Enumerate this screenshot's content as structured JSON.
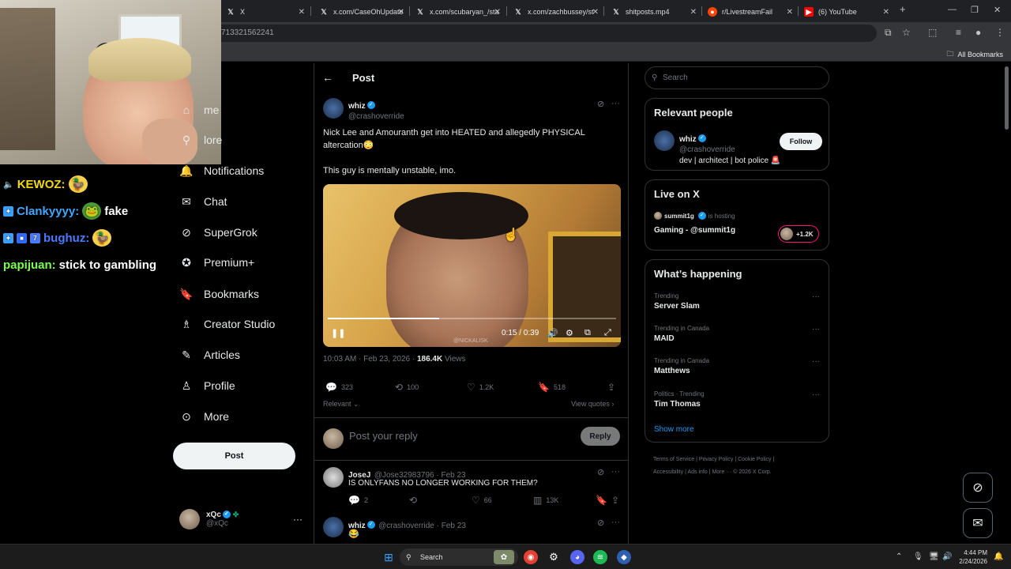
{
  "browser": {
    "tabs": [
      {
        "label": "X",
        "icon": "x-logo-icon"
      },
      {
        "label": "x.com/CaseOhUpdate",
        "icon": "x-logo-icon"
      },
      {
        "label": "x.com/scubaryan_/sta",
        "icon": "x-logo-icon"
      },
      {
        "label": "x.com/zachbussey/st",
        "icon": "x-logo-icon"
      },
      {
        "label": "shitposts.mp4",
        "icon": "x-logo-icon"
      },
      {
        "label": "r/LivestreamFail",
        "icon": "reddit-icon"
      },
      {
        "label": "(6) YouTube",
        "icon": "youtube-icon"
      }
    ],
    "new_tab": "+",
    "address": "713321562241",
    "all_bookmarks": "All Bookmarks"
  },
  "chat": [
    {
      "user": "KEWOZ:",
      "color": "#f5d90a",
      "message": ""
    },
    {
      "user": "Clankyyyy:",
      "color": "#3ea6ff",
      "message": "fake"
    },
    {
      "user": "bughuz:",
      "color": "#4a7bff",
      "message": ""
    },
    {
      "user": "papijuan:",
      "color": "#7cff4f",
      "message": "stick to gambling"
    }
  ],
  "nav": {
    "items": [
      {
        "label": "me",
        "icon": "home-icon"
      },
      {
        "label": "lore",
        "icon": "search-icon"
      },
      {
        "label": "Notifications",
        "icon": "bell-icon"
      },
      {
        "label": "Chat",
        "icon": "mail-icon"
      },
      {
        "label": "SuperGrok",
        "icon": "grok-icon"
      },
      {
        "label": "Premium+",
        "icon": "verified-icon"
      },
      {
        "label": "Bookmarks",
        "icon": "bookmark-icon"
      },
      {
        "label": "Creator Studio",
        "icon": "creator-studio-icon"
      },
      {
        "label": "Articles",
        "icon": "articles-icon"
      },
      {
        "label": "Profile",
        "icon": "person-icon"
      },
      {
        "label": "More",
        "icon": "more-circle-icon"
      }
    ],
    "post_button": "Post",
    "account": {
      "name": "xQc",
      "handle": "@xQc"
    }
  },
  "main": {
    "header_title": "Post",
    "tweet": {
      "name": "whiz",
      "handle": "@crashoverride",
      "text_line1": "Nick Lee and Amouranth get into HEATED and allegedly PHYSICAL",
      "text_line2": "altercation😳",
      "text_line3": "This guy is mentally unstable, imo.",
      "video_time": "0:15 / 0:39",
      "video_progress": 0.385,
      "video_watermark": "@NICKALISK",
      "timestamp": "10:03 AM · Feb 23, 2026 · ",
      "views_count": "186.4K",
      "views_label": " Views",
      "replies": "323",
      "reposts": "100",
      "likes": "1.2K",
      "bookmarks": "518"
    },
    "sort_label": "Relevant",
    "view_quotes": "View quotes",
    "reply_placeholder": "Post your reply",
    "reply_button": "Reply",
    "replies": [
      {
        "name": "JoseJ",
        "handle": "@Jose32983796 · Feb 23",
        "text": "IS ONLYFANS NO LONGER WORKING FOR THEM?",
        "replies": "2",
        "likes": "66",
        "views": "13K"
      },
      {
        "name": "whiz",
        "handle": "@crashoverride · Feb 23",
        "text": "😂"
      }
    ]
  },
  "sidebar": {
    "search_placeholder": "Search",
    "relevant_title": "Relevant people",
    "person": {
      "name": "whiz",
      "handle": "@crashoverride",
      "bio": "dev | architect | bot police 🚨",
      "follow": "Follow"
    },
    "live_title": "Live on X",
    "live": {
      "host": "summit1g",
      "hosting_label": "is hosting",
      "title": "Gaming - @summit1g",
      "listeners": "+1.2K"
    },
    "happening_title": "What’s happening",
    "trends": [
      {
        "category": "Trending",
        "name": "Server Slam"
      },
      {
        "category": "Trending in Canada",
        "name": "MAID"
      },
      {
        "category": "Trending in Canada",
        "name": "Matthews"
      },
      {
        "category": "Politics · Trending",
        "name": "Tim Thomas"
      }
    ],
    "show_more": "Show more",
    "footer_line1": "Terms of Service  |  Privacy Policy  |  Cookie Policy  |",
    "footer_line2": "Accessibility  |  Ads info  |  More ···  © 2026 X Corp."
  },
  "taskbar": {
    "search": "Search",
    "time": "4:44 PM",
    "date": "2/24/2026"
  }
}
